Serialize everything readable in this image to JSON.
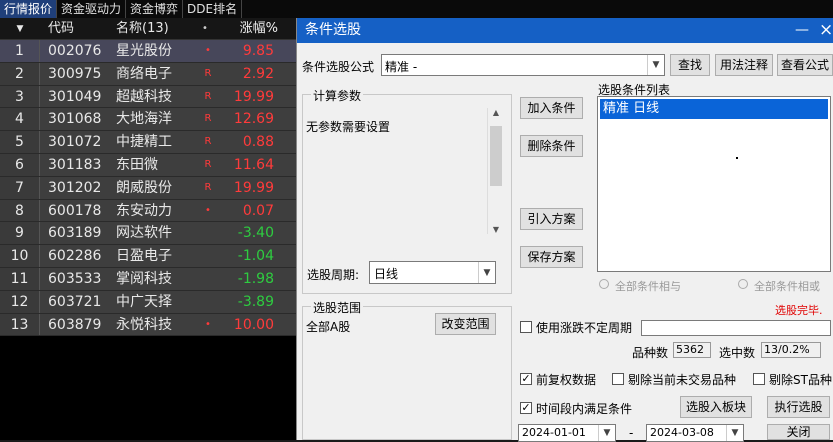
{
  "tabs": [
    "行情报价",
    "资金驱动力",
    "资金博弈",
    "DDE排名"
  ],
  "grid": {
    "headers": {
      "code": "代码",
      "name": "名称(13)",
      "dot": "•",
      "pct": "涨幅%"
    },
    "rows": [
      {
        "idx": "1",
        "code": "002076",
        "name": "星光股份",
        "flag": "•",
        "pct": "9.85",
        "dir": "up"
      },
      {
        "idx": "2",
        "code": "300975",
        "name": "商络电子",
        "flag": "R",
        "pct": "2.92",
        "dir": "up"
      },
      {
        "idx": "3",
        "code": "301049",
        "name": "超越科技",
        "flag": "R",
        "pct": "19.99",
        "dir": "up"
      },
      {
        "idx": "4",
        "code": "301068",
        "name": "大地海洋",
        "flag": "R",
        "pct": "12.69",
        "dir": "up"
      },
      {
        "idx": "5",
        "code": "301072",
        "name": "中捷精工",
        "flag": "R",
        "pct": "0.88",
        "dir": "up"
      },
      {
        "idx": "6",
        "code": "301183",
        "name": "东田微",
        "flag": "R",
        "pct": "11.64",
        "dir": "up"
      },
      {
        "idx": "7",
        "code": "301202",
        "name": "朗威股份",
        "flag": "R",
        "pct": "19.99",
        "dir": "up"
      },
      {
        "idx": "8",
        "code": "600178",
        "name": "东安动力",
        "flag": "•",
        "pct": "0.07",
        "dir": "up"
      },
      {
        "idx": "9",
        "code": "603189",
        "name": "网达软件",
        "flag": "",
        "pct": "-3.40",
        "dir": "dn"
      },
      {
        "idx": "10",
        "code": "602286",
        "name": "日盈电子",
        "flag": "",
        "pct": "-1.04",
        "dir": "dn"
      },
      {
        "idx": "11",
        "code": "603533",
        "name": "掌阅科技",
        "flag": "",
        "pct": "-1.98",
        "dir": "dn"
      },
      {
        "idx": "12",
        "code": "603721",
        "name": "中广天择",
        "flag": "",
        "pct": "-3.89",
        "dir": "dn"
      },
      {
        "idx": "13",
        "code": "603879",
        "name": "永悦科技",
        "flag": "•",
        "pct": "10.00",
        "dir": "up"
      }
    ]
  },
  "dialog": {
    "title": "条件选股",
    "minimize": "—",
    "close": "×",
    "formula_label": "条件选股公式",
    "formula_value": "精准  -",
    "find": "查找",
    "usage": "用法注释",
    "view": "查看公式",
    "params_title": "计算参数",
    "params_text": "无参数需要设置",
    "period_label": "选股周期:",
    "period_value": "日线",
    "add": "加入条件",
    "delete": "删除条件",
    "import": "引入方案",
    "save": "保存方案",
    "list_title": "选股条件列表",
    "list_item": "精准  日线",
    "and_label": "全部条件相与",
    "or_label": "全部条件相或",
    "done": "选股完毕.",
    "range_title": "选股范围",
    "range_value": "全部A股",
    "change_range": "改变范围",
    "use_period": "使用涨跌不定周期",
    "count_label": "品种数",
    "count_value": "5362",
    "selected_label": "选中数",
    "selected_value": "13/0.2%",
    "prefq": "前复权数据",
    "excl_untraded": "剔除当前未交易品种",
    "excl_st": "剔除ST品种",
    "interval": "时间段内满足条件",
    "to_block": "选股入板块",
    "execute": "执行选股",
    "date_from": "2024-01-01",
    "dash": "-",
    "date_to": "2024-03-08",
    "close_btn": "关闭"
  }
}
